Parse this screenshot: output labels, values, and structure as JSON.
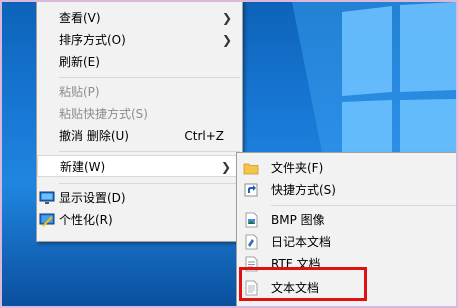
{
  "context_menu": {
    "items": [
      {
        "label": "查看(V)"
      },
      {
        "label": "排序方式(O)"
      },
      {
        "label": "刷新(E)"
      },
      {
        "label": "粘贴(P)"
      },
      {
        "label": "粘贴快捷方式(S)"
      },
      {
        "label": "撤消 删除(U)",
        "shortcut": "Ctrl+Z"
      },
      {
        "label": "新建(W)"
      },
      {
        "label": "显示设置(D)",
        "icon": "display-settings-icon"
      },
      {
        "label": "个性化(R)",
        "icon": "personalize-icon"
      }
    ]
  },
  "new_submenu": {
    "items": [
      {
        "label": "文件夹(F)",
        "icon": "folder-icon"
      },
      {
        "label": "快捷方式(S)",
        "icon": "shortcut-icon"
      },
      {
        "label": "BMP 图像",
        "icon": "bmp-image-icon"
      },
      {
        "label": "日记本文档",
        "icon": "journal-document-icon"
      },
      {
        "label": "RTF 文档",
        "icon": "rtf-document-icon"
      },
      {
        "label": "文本文档",
        "icon": "text-document-icon"
      }
    ]
  },
  "colors": {
    "accent": "#e01010",
    "desktop": "#1877d4",
    "menu_bg": "#f2f2f2"
  }
}
